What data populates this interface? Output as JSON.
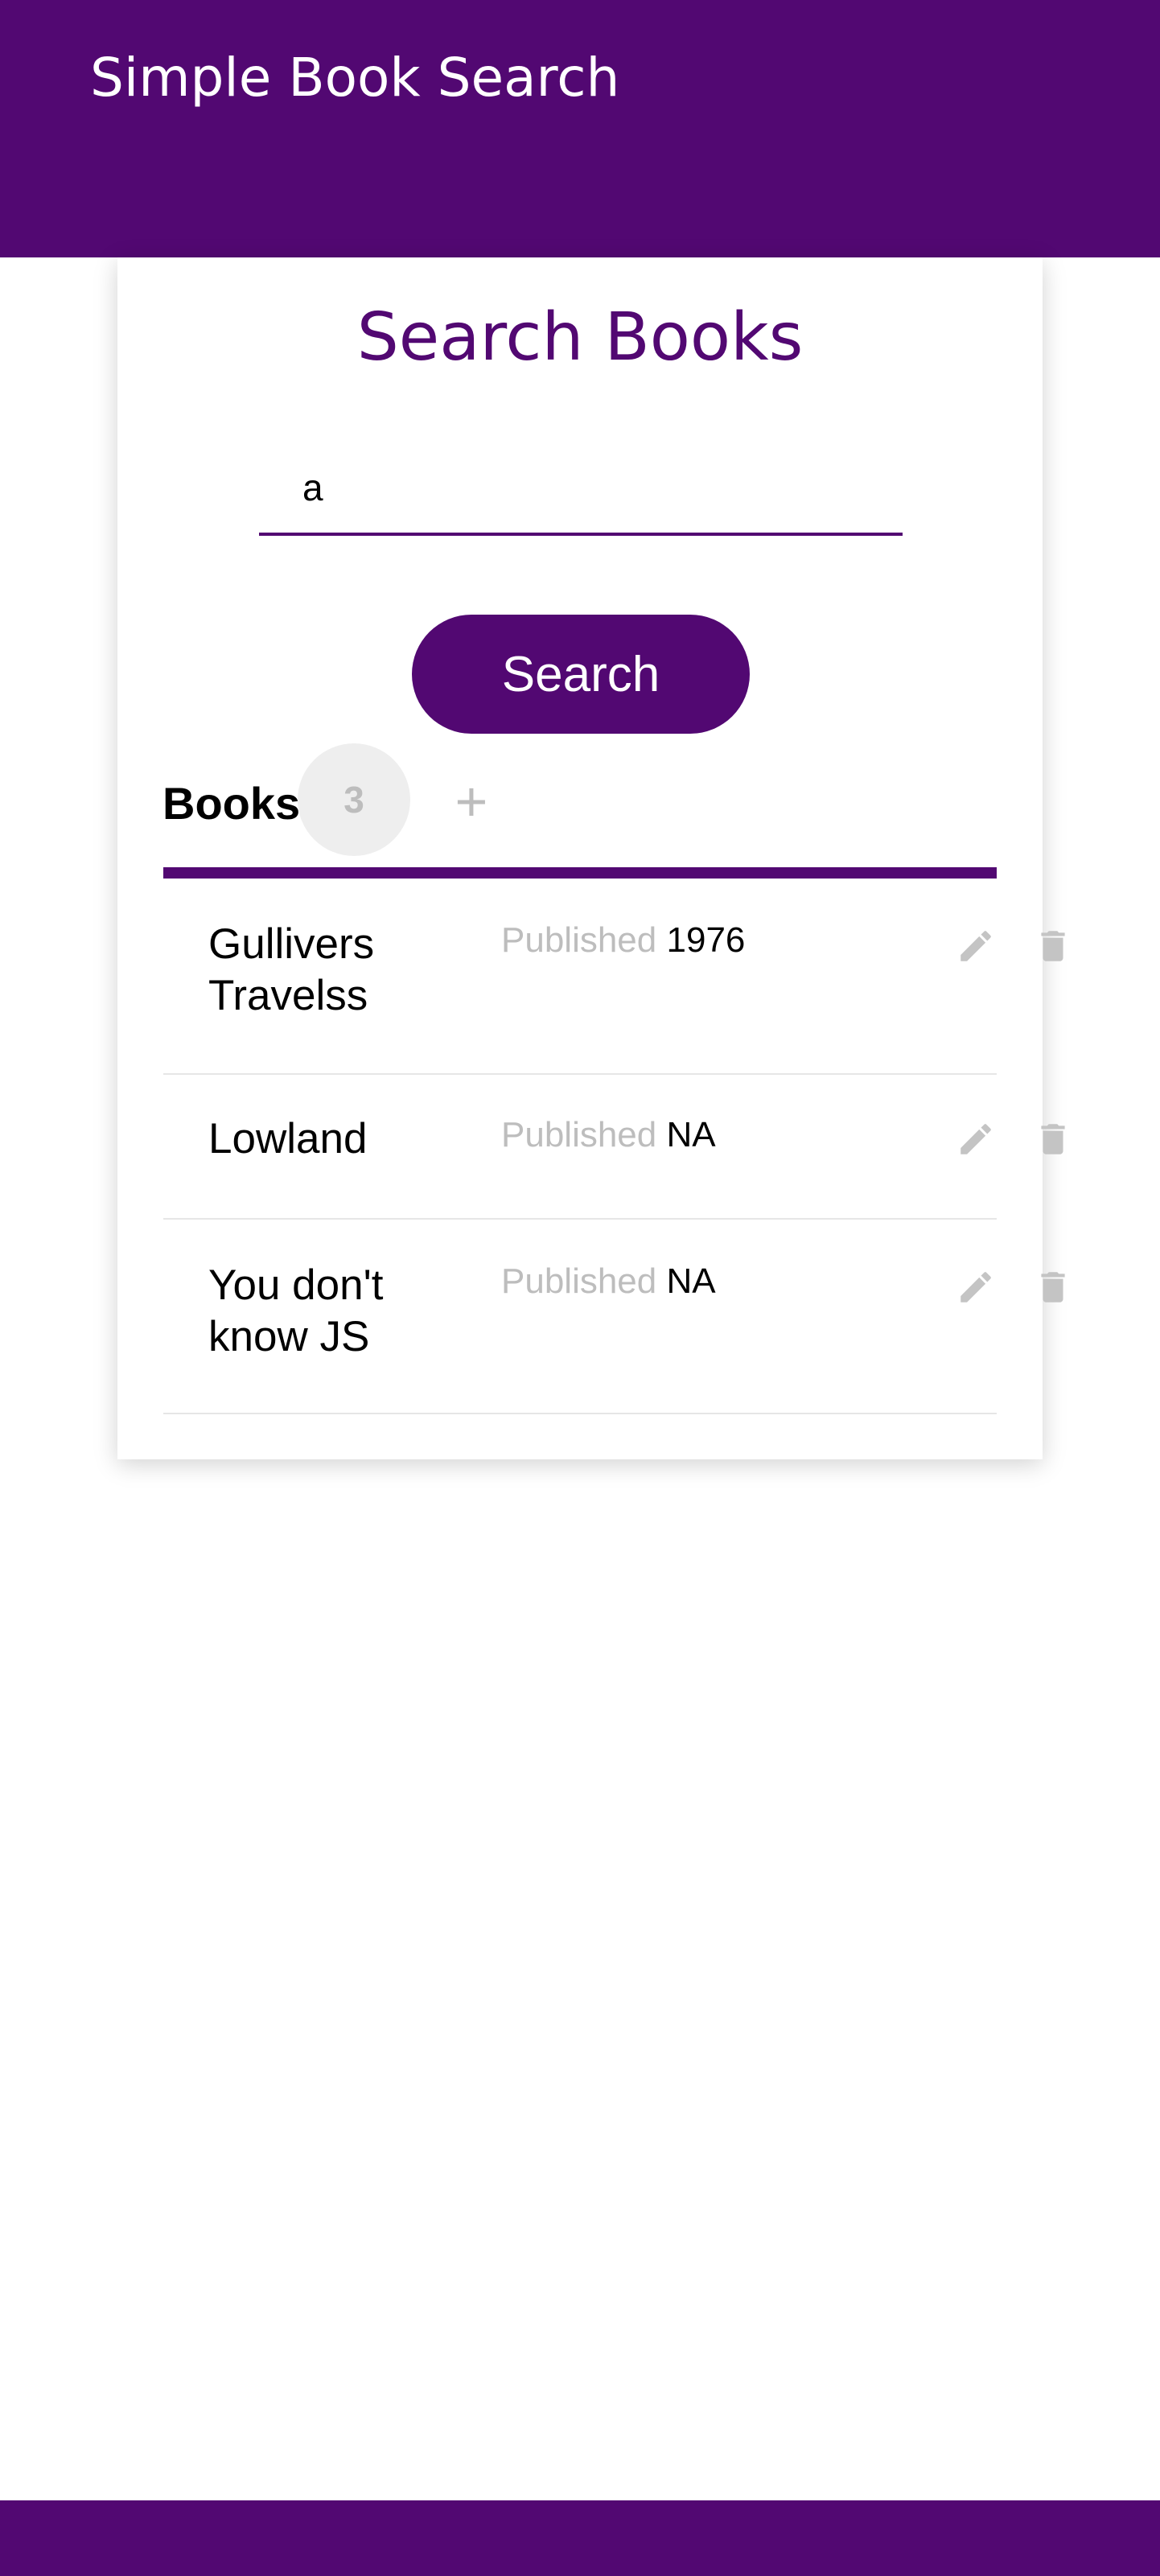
{
  "app_bar": {
    "title": "Simple Book Search",
    "color": "#520872"
  },
  "search_card": {
    "title": "Search Books",
    "search_input": {
      "value": "a",
      "placeholder": ""
    },
    "search_button_label": "Search"
  },
  "tabs": {
    "books_label": "Books",
    "count": "3",
    "add_label": "+"
  },
  "books": [
    {
      "title": "Gullivers Travelss",
      "published_label": "Published",
      "published": "1976"
    },
    {
      "title": "Lowland",
      "published_label": "Published",
      "published": "NA"
    },
    {
      "title": "You don't know JS",
      "published_label": "Published",
      "published": "NA"
    }
  ],
  "icons": {
    "edit": "pencil-icon",
    "delete": "trash-icon"
  },
  "colors": {
    "accent": "#520872",
    "muted": "#bdbdbd",
    "badge_bg": "#eeeeee"
  }
}
